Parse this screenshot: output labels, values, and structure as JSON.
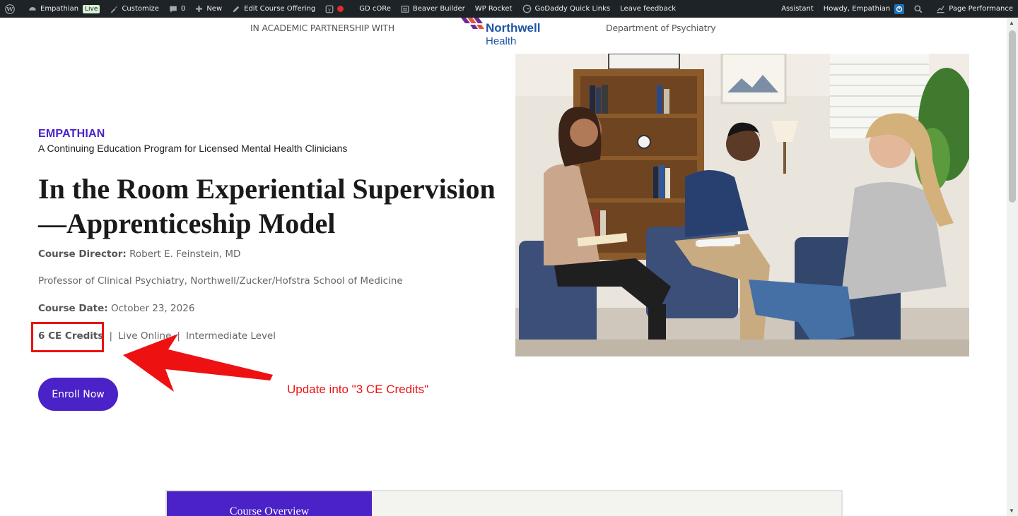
{
  "adminbar": {
    "site_name": "Empathian",
    "live_badge": "Live",
    "customize": "Customize",
    "comments_count": "0",
    "new": "New",
    "edit_course": "Edit Course Offering",
    "gd_core": "GD cORe",
    "beaver_builder": "Beaver Builder",
    "wp_rocket": "WP Rocket",
    "godaddy_links": "GoDaddy Quick Links",
    "leave_feedback": "Leave feedback",
    "assistant": "Assistant",
    "howdy": "Howdy, Empathian",
    "page_performance": "Page Performance"
  },
  "partner": {
    "text": "IN ACADEMIC PARTNERSHIP WITH",
    "logo_line1": "Northwell",
    "logo_line2": "Health",
    "department": "Department of Psychiatry"
  },
  "hero": {
    "brand": "EMPATHIAN",
    "subtitle": "A Continuing Education Program for Licensed Mental Health Clinicians",
    "title": "In the Room Experiential Supervision —Apprenticeship Model",
    "director_label": "Course Director:",
    "director_value": "Robert E. Feinstein, MD",
    "professor": "Professor of Clinical Psychiatry, Northwell/Zucker/Hofstra School of Medicine",
    "date_label": "Course Date:",
    "date_value": "October 23, 2026",
    "credits": "6 CE Credits",
    "separator": "|",
    "format": "Live Online",
    "level": "Intermediate Level",
    "enroll_label": "Enroll Now"
  },
  "annotation": {
    "text": "Update into \"3 CE Credits\"",
    "color": "#ee1111"
  },
  "tabs": {
    "overview": "Course Overview"
  },
  "colors": {
    "brand_purple": "#4a22c8",
    "adminbar_bg": "#1d2327",
    "northwell_blue": "#1f55a5"
  }
}
